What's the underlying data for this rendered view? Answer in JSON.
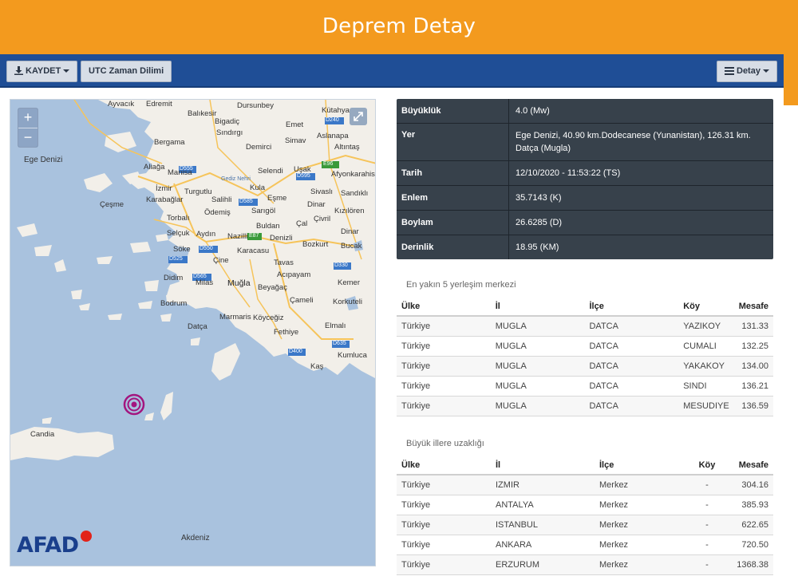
{
  "header": {
    "title": "Deprem Detay"
  },
  "toolbar": {
    "save_label": "KAYDET",
    "utc_label": "UTC Zaman Dilimi",
    "detail_label": "Detay"
  },
  "map": {
    "zoom_in": "+",
    "zoom_out": "−",
    "brand": "AFAD",
    "labels": {
      "ege_denizi": "Ege Denizi",
      "akdeniz": "Akdeniz",
      "candia": "Candia",
      "ayvacik": "Ayvacık",
      "edremit": "Edremit",
      "balikesir": "Balıkesir",
      "dursunbey": "Dursunbey",
      "kutahya": "Kütahya",
      "bigadic": "Bigadiç",
      "sindirgi": "Sındırgı",
      "emet": "Emet",
      "bergama": "Bergama",
      "aslanapa": "Aslanapa",
      "simav": "Simav",
      "demirci": "Demirci",
      "altintas": "Altıntaş",
      "aliaga": "Aliağa",
      "manisa": "Manisa",
      "selendi": "Selendi",
      "usak": "Uşak",
      "afyonkarahisar": "Afyonkarahisar",
      "izmir": "İzmir",
      "turgutlu": "Turgutlu",
      "gediz_nehri": "Gediz Nehri",
      "kula": "Kula",
      "sivasli": "Sivaslı",
      "sandikli": "Sandıklı",
      "cesme": "Çeşme",
      "karabaglar": "Karabağlar",
      "salihli": "Salihli",
      "esme": "Eşme",
      "dinar": "Dinar",
      "torbali": "Torbalı",
      "odemis": "Ödemiş",
      "sarigol": "Sarıgöl",
      "civril": "Çivril",
      "kiziloren": "Kızılören",
      "buldan": "Buldan",
      "cal": "Çal",
      "selcuk": "Selçuk",
      "aydin": "Aydın",
      "nazilli": "Nazilli",
      "denizli": "Denizli",
      "dinar2": "Dinar",
      "soke": "Söke",
      "karacasu": "Karacasu",
      "bozkurt": "Bozkurt",
      "bucak": "Bucak",
      "cine": "Çine",
      "tavas": "Tavas",
      "didim": "Didim",
      "milas": "Milas",
      "acipayam": "Acıpayam",
      "mugla": "Muğla",
      "beyagac": "Beyağaç",
      "kemer": "Kemer",
      "bodrum": "Bodrum",
      "camali": "Çameli",
      "korkuteli": "Korkuteli",
      "marmaris": "Marmaris",
      "koycegiz": "Köyceğiz",
      "datca": "Datça",
      "fethiye": "Fethiye",
      "elmali": "Elmalı",
      "kumluca": "Kumluca",
      "kas": "Kaş",
      "e96": "E96",
      "e87": "E87",
      "d555": "D555",
      "d565": "D565",
      "d585": "D585",
      "d595": "D595",
      "d240": "D240",
      "d330": "D330",
      "d400": "D400",
      "d525": "D525",
      "d550": "D550",
      "d635": "D635"
    }
  },
  "details": [
    {
      "key": "Büyüklük",
      "value": "4.0 (Mw)"
    },
    {
      "key": "Yer",
      "value": "Ege Denizi, 40.90 km.Dodecanese (Yunanistan), 126.31 km. Datça (Mugla)"
    },
    {
      "key": "Tarih",
      "value": "12/10/2020 - 11:53:22 (TS)"
    },
    {
      "key": "Enlem",
      "value": "35.7143 (K)"
    },
    {
      "key": "Boylam",
      "value": "26.6285 (D)"
    },
    {
      "key": "Derinlik",
      "value": "18.95 (KM)"
    }
  ],
  "nearest": {
    "title": "En yakın 5 yerleşim merkezi",
    "headers": [
      "Ülke",
      "İl",
      "İlçe",
      "Köy",
      "Mesafe"
    ],
    "rows": [
      [
        "Türkiye",
        "MUGLA",
        "DATCA",
        "YAZIKOY",
        "131.33"
      ],
      [
        "Türkiye",
        "MUGLA",
        "DATCA",
        "CUMALI",
        "132.25"
      ],
      [
        "Türkiye",
        "MUGLA",
        "DATCA",
        "YAKAKOY",
        "134.00"
      ],
      [
        "Türkiye",
        "MUGLA",
        "DATCA",
        "SINDI",
        "136.21"
      ],
      [
        "Türkiye",
        "MUGLA",
        "DATCA",
        "MESUDIYE",
        "136.59"
      ]
    ]
  },
  "cities": {
    "title": "Büyük illere uzaklığı",
    "headers": [
      "Ülke",
      "İl",
      "İlçe",
      "Köy",
      "Mesafe"
    ],
    "rows": [
      [
        "Türkiye",
        "IZMIR",
        "Merkez",
        "-",
        "304.16"
      ],
      [
        "Türkiye",
        "ANTALYA",
        "Merkez",
        "-",
        "385.93"
      ],
      [
        "Türkiye",
        "ISTANBUL",
        "Merkez",
        "-",
        "622.65"
      ],
      [
        "Türkiye",
        "ANKARA",
        "Merkez",
        "-",
        "720.50"
      ],
      [
        "Türkiye",
        "ERZURUM",
        "Merkez",
        "-",
        "1368.38"
      ]
    ]
  },
  "colors": {
    "header_orange": "#f39a1e",
    "toolbar_blue": "#1f4e96",
    "detail_panel": "#37414b",
    "quake_marker": "#a3157f",
    "sea": "#a9c2de",
    "land": "#f2efe9"
  }
}
